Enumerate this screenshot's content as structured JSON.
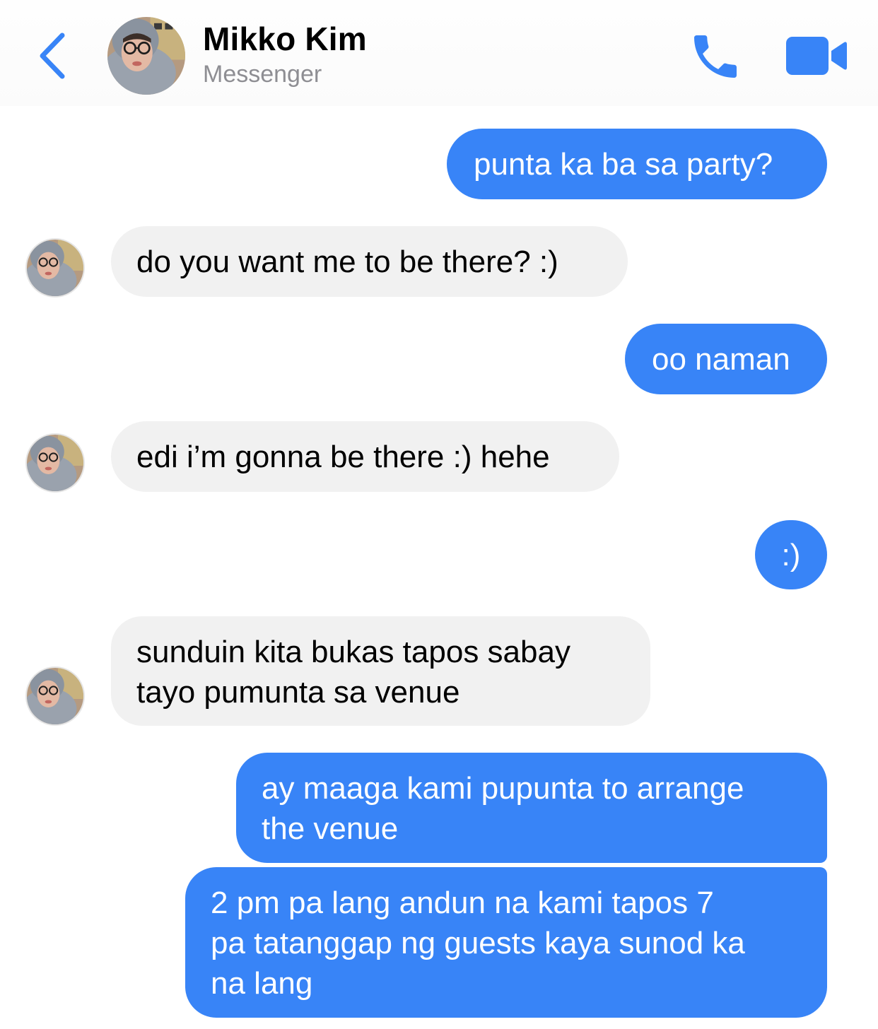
{
  "header": {
    "back_icon": "chevron-left-icon",
    "contact_name": "Mikko Kim",
    "subtitle": "Messenger",
    "call_icon": "phone-icon",
    "video_icon": "video-camera-icon"
  },
  "colors": {
    "accent": "#3884f7",
    "incoming_bubble": "#f1f1f1",
    "subtitle_gray": "#8e8e93"
  },
  "messages": [
    {
      "from": "me",
      "lines": [
        "punta ka ba sa party?"
      ]
    },
    {
      "from": "contact",
      "lines": [
        "do you want me to be there? :)"
      ]
    },
    {
      "from": "me",
      "lines": [
        "oo naman"
      ]
    },
    {
      "from": "contact",
      "lines": [
        "edi i’m gonna be there :) hehe"
      ]
    },
    {
      "from": "me",
      "lines": [
        ":)"
      ]
    },
    {
      "from": "contact",
      "lines": [
        "sunduin kita bukas tapos sabay",
        "tayo pumunta sa venue"
      ]
    },
    {
      "from": "me",
      "lines": [
        "ay maaga kami pupunta to arrange",
        "the venue"
      ]
    },
    {
      "from": "me",
      "lines": [
        "2 pm pa lang andun na kami tapos 7",
        "pa tatanggap ng guests kaya sunod ka",
        "na lang"
      ]
    }
  ]
}
